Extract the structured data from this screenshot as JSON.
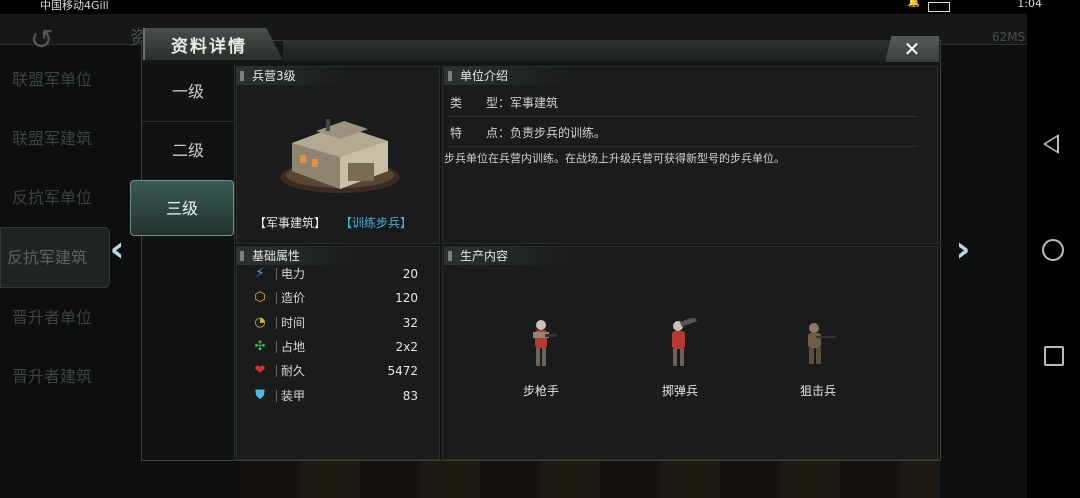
{
  "status_bar": {
    "carrier": "中国移动4Gill",
    "time": "1:04"
  },
  "background": {
    "title": "资料图鉴",
    "fps": "62MS",
    "menu": [
      "联盟军单位",
      "联盟军建筑",
      "反抗军单位",
      "反抗军建筑",
      "晋升者单位",
      "晋升者建筑"
    ]
  },
  "dialog": {
    "title": "资料详情",
    "close_label": "✕",
    "tabs": [
      "一级",
      "二级",
      "三级"
    ],
    "building": {
      "name": "兵营3级",
      "tag_type": "【军事建筑】",
      "tag_role": "【训练步兵】"
    },
    "attributes_title": "基础属性",
    "attributes": [
      {
        "icon": "lightning-icon",
        "glyph": "⚡",
        "color": "#3fa9e0",
        "label": "电力",
        "value": "20"
      },
      {
        "icon": "cube-icon",
        "glyph": "⬡",
        "color": "#e6b422",
        "label": "造价",
        "value": "120"
      },
      {
        "icon": "clock-icon",
        "glyph": "◔",
        "color": "#d9b341",
        "label": "时间",
        "value": "32"
      },
      {
        "icon": "area-icon",
        "glyph": "✣",
        "color": "#3fbf4a",
        "label": "占地",
        "value": "2x2"
      },
      {
        "icon": "heart-icon",
        "glyph": "❤",
        "color": "#d8322f",
        "label": "耐久",
        "value": "5472"
      },
      {
        "icon": "armor-icon",
        "glyph": "⛊",
        "color": "#4ab7e0",
        "label": "装甲",
        "value": "83"
      }
    ],
    "intro_title": "单位介绍",
    "type_label": "类　　型：",
    "type_value": "军事建筑",
    "feature_label": "特　　点：",
    "feature_value": "负责步兵的训练。",
    "description": "步兵单位在兵营内训练。在战场上升级兵营可获得新型号的步兵单位。",
    "production_title": "生产内容",
    "units": [
      "步枪手",
      "掷弹兵",
      "狙击兵"
    ]
  }
}
